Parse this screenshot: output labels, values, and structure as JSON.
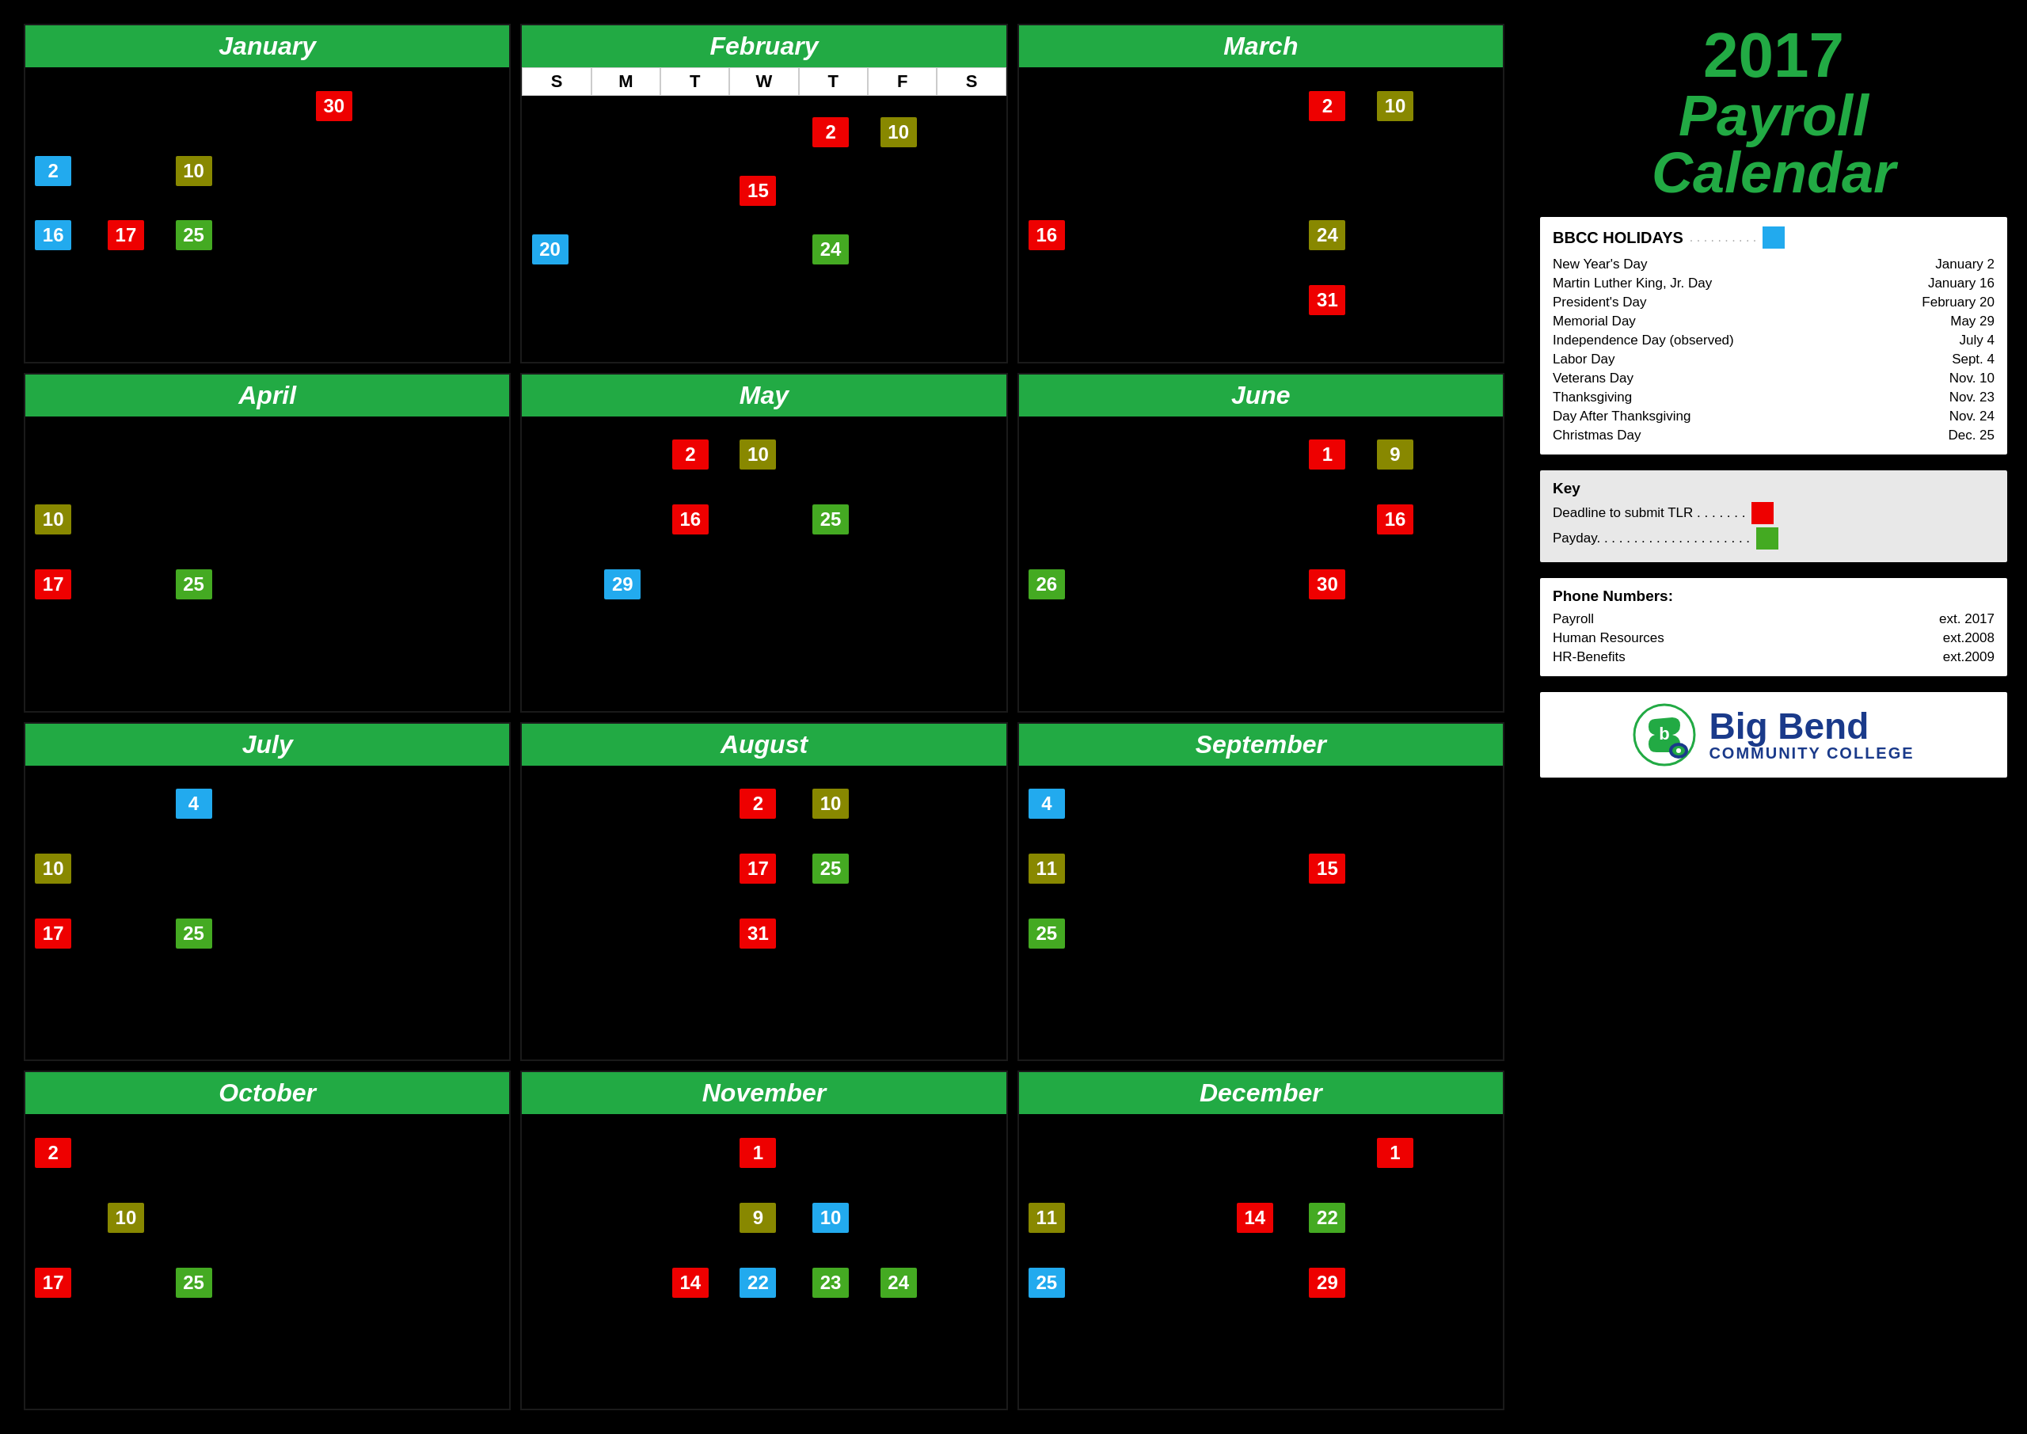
{
  "title": "2017 Payroll Calendar",
  "year": "2017",
  "payroll_label": "Payroll",
  "calendar_label": "Calendar",
  "months": [
    {
      "name": "January",
      "show_header": false,
      "badges": [
        {
          "day": "30",
          "type": "red",
          "col": 5,
          "row": 1
        },
        {
          "day": "2",
          "type": "blue",
          "col": 1,
          "row": 2
        },
        {
          "day": "10",
          "type": "olive",
          "col": 3,
          "row": 2
        },
        {
          "day": "16",
          "type": "blue",
          "col": 1,
          "row": 3
        },
        {
          "day": "17",
          "type": "red",
          "col": 2,
          "row": 3
        },
        {
          "day": "25",
          "type": "green",
          "col": 3,
          "row": 3
        }
      ]
    },
    {
      "name": "February",
      "show_header": true,
      "header": [
        "S",
        "M",
        "T",
        "W",
        "T",
        "F",
        "S"
      ],
      "badges": [
        {
          "day": "2",
          "type": "red",
          "col": 5,
          "row": 1
        },
        {
          "day": "10",
          "type": "olive",
          "col": 6,
          "row": 1
        },
        {
          "day": "15",
          "type": "red",
          "col": 4,
          "row": 2
        },
        {
          "day": "20",
          "type": "blue",
          "col": 1,
          "row": 3
        },
        {
          "day": "24",
          "type": "green",
          "col": 5,
          "row": 3
        }
      ]
    },
    {
      "name": "March",
      "show_header": false,
      "badges": [
        {
          "day": "2",
          "type": "red",
          "col": 5,
          "row": 1
        },
        {
          "day": "10",
          "type": "olive",
          "col": 6,
          "row": 1
        },
        {
          "day": "16",
          "type": "red",
          "col": 1,
          "row": 3
        },
        {
          "day": "24",
          "type": "olive",
          "col": 5,
          "row": 3
        },
        {
          "day": "31",
          "type": "red",
          "col": 5,
          "row": 4
        }
      ]
    },
    {
      "name": "April",
      "show_header": false,
      "badges": [
        {
          "day": "10",
          "type": "olive",
          "col": 1,
          "row": 2
        },
        {
          "day": "17",
          "type": "red",
          "col": 1,
          "row": 3
        },
        {
          "day": "25",
          "type": "green",
          "col": 3,
          "row": 3
        }
      ]
    },
    {
      "name": "May",
      "show_header": false,
      "badges": [
        {
          "day": "2",
          "type": "red",
          "col": 3,
          "row": 1
        },
        {
          "day": "10",
          "type": "olive",
          "col": 4,
          "row": 1
        },
        {
          "day": "16",
          "type": "red",
          "col": 3,
          "row": 2
        },
        {
          "day": "25",
          "type": "green",
          "col": 5,
          "row": 2
        },
        {
          "day": "29",
          "type": "blue",
          "col": 2,
          "row": 3
        }
      ]
    },
    {
      "name": "June",
      "show_header": false,
      "badges": [
        {
          "day": "1",
          "type": "red",
          "col": 5,
          "row": 1
        },
        {
          "day": "9",
          "type": "olive",
          "col": 6,
          "row": 1
        },
        {
          "day": "16",
          "type": "red",
          "col": 6,
          "row": 2
        },
        {
          "day": "26",
          "type": "green",
          "col": 1,
          "row": 3
        },
        {
          "day": "30",
          "type": "red",
          "col": 5,
          "row": 3
        }
      ]
    },
    {
      "name": "July",
      "show_header": false,
      "badges": [
        {
          "day": "4",
          "type": "blue",
          "col": 3,
          "row": 1
        },
        {
          "day": "10",
          "type": "olive",
          "col": 1,
          "row": 2
        },
        {
          "day": "17",
          "type": "red",
          "col": 1,
          "row": 3
        },
        {
          "day": "25",
          "type": "green",
          "col": 3,
          "row": 3
        }
      ]
    },
    {
      "name": "August",
      "show_header": false,
      "badges": [
        {
          "day": "2",
          "type": "red",
          "col": 4,
          "row": 1
        },
        {
          "day": "10",
          "type": "olive",
          "col": 5,
          "row": 1
        },
        {
          "day": "17",
          "type": "red",
          "col": 4,
          "row": 2
        },
        {
          "day": "25",
          "type": "green",
          "col": 5,
          "row": 2
        },
        {
          "day": "31",
          "type": "red",
          "col": 4,
          "row": 3
        }
      ]
    },
    {
      "name": "September",
      "show_header": false,
      "badges": [
        {
          "day": "4",
          "type": "blue",
          "col": 1,
          "row": 1
        },
        {
          "day": "11",
          "type": "olive",
          "col": 1,
          "row": 2
        },
        {
          "day": "15",
          "type": "red",
          "col": 5,
          "row": 2
        },
        {
          "day": "25",
          "type": "green",
          "col": 1,
          "row": 3
        }
      ]
    },
    {
      "name": "October",
      "show_header": false,
      "badges": [
        {
          "day": "2",
          "type": "red",
          "col": 1,
          "row": 1
        },
        {
          "day": "10",
          "type": "olive",
          "col": 2,
          "row": 2
        },
        {
          "day": "17",
          "type": "red",
          "col": 1,
          "row": 3
        },
        {
          "day": "25",
          "type": "green",
          "col": 3,
          "row": 3
        }
      ]
    },
    {
      "name": "November",
      "show_header": false,
      "badges": [
        {
          "day": "1",
          "type": "red",
          "col": 4,
          "row": 1
        },
        {
          "day": "9",
          "type": "olive",
          "col": 4,
          "row": 2
        },
        {
          "day": "10",
          "type": "blue",
          "col": 5,
          "row": 2
        },
        {
          "day": "14",
          "type": "red",
          "col": 3,
          "row": 3
        },
        {
          "day": "22",
          "type": "blue",
          "col": 4,
          "row": 3
        },
        {
          "day": "23",
          "type": "green",
          "col": 5,
          "row": 3
        },
        {
          "day": "24",
          "type": "green",
          "col": 6,
          "row": 3
        }
      ]
    },
    {
      "name": "December",
      "show_header": false,
      "badges": [
        {
          "day": "1",
          "type": "red",
          "col": 6,
          "row": 1
        },
        {
          "day": "11",
          "type": "olive",
          "col": 1,
          "row": 2
        },
        {
          "day": "14",
          "type": "red",
          "col": 4,
          "row": 2
        },
        {
          "day": "22",
          "type": "green",
          "col": 5,
          "row": 2
        },
        {
          "day": "25",
          "type": "blue",
          "col": 1,
          "row": 3
        },
        {
          "day": "29",
          "type": "red",
          "col": 5,
          "row": 3
        }
      ]
    }
  ],
  "holidays": {
    "title": "BBCC HOLIDAYS",
    "dots": ". . . . . . . . . .",
    "items": [
      {
        "name": "New Year's Day",
        "date": "January 2"
      },
      {
        "name": "Martin Luther King, Jr. Day",
        "date": "January 16"
      },
      {
        "name": "President's Day",
        "date": "February 20"
      },
      {
        "name": "Memorial Day",
        "date": "May 29"
      },
      {
        "name": "Independence Day (observed)",
        "date": "July 4"
      },
      {
        "name": "Labor Day",
        "date": "Sept. 4"
      },
      {
        "name": "Veterans Day",
        "date": "Nov. 10"
      },
      {
        "name": "Thanksgiving",
        "date": "Nov. 23"
      },
      {
        "name": "Day After Thanksgiving",
        "date": "Nov. 24"
      },
      {
        "name": "Christmas Day",
        "date": "Dec. 25"
      }
    ]
  },
  "key": {
    "title": "Key",
    "tlr_label": "Deadline to submit TLR . . . . . . .",
    "payday_label": "Payday. . . . . . . . . . . . . . . . . . . . ."
  },
  "phones": {
    "title": "Phone Numbers:",
    "items": [
      {
        "dept": "Payroll",
        "ext": "ext. 2017"
      },
      {
        "dept": "Human Resources",
        "ext": "ext.2008"
      },
      {
        "dept": "HR-Benefits",
        "ext": "ext.2009"
      }
    ]
  },
  "logo": {
    "name": "Big Bend",
    "subtitle": "COMMUNITY COLLEGE"
  }
}
